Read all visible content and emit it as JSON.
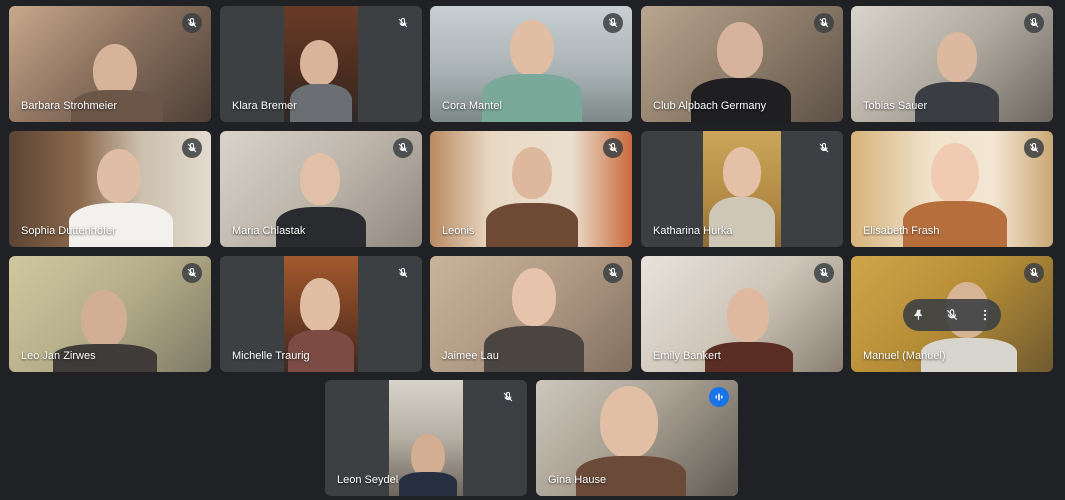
{
  "participants": [
    {
      "name": "Barbara Strohmeier",
      "muted": true
    },
    {
      "name": "Klara Bremer",
      "muted": true
    },
    {
      "name": "Cora Mantel",
      "muted": true
    },
    {
      "name": "Club Alpbach Germany",
      "muted": true
    },
    {
      "name": "Tobias Sauer",
      "muted": true
    },
    {
      "name": "Sophia Duttenhöfer",
      "muted": true
    },
    {
      "name": "Maria Chlastak",
      "muted": true
    },
    {
      "name": "Leonis",
      "muted": true
    },
    {
      "name": "Katharina Hurka",
      "muted": true
    },
    {
      "name": "Elisabeth Frash",
      "muted": true
    },
    {
      "name": "Leo Jan Zirwes",
      "muted": true
    },
    {
      "name": "Michelle Traurig",
      "muted": true
    },
    {
      "name": "Jaimee Lau",
      "muted": true
    },
    {
      "name": "Emily Bankert",
      "muted": true
    },
    {
      "name": "Manuel (Manuel)",
      "muted": true
    },
    {
      "name": "Leon Seydel",
      "muted": true
    },
    {
      "name": "Gina Hause",
      "muted": false,
      "speaking": true
    }
  ],
  "icons": {
    "mic_off": "mic-off-icon",
    "speaking": "audio-level-icon",
    "pin": "pin-icon",
    "mute": "mic-off-icon",
    "more": "more-vert-icon"
  },
  "colors": {
    "background": "#202124",
    "tile_placeholder": "#3c4043",
    "active_speaker_border": "#8ab4f8",
    "speaking_badge": "#1a73e8"
  }
}
